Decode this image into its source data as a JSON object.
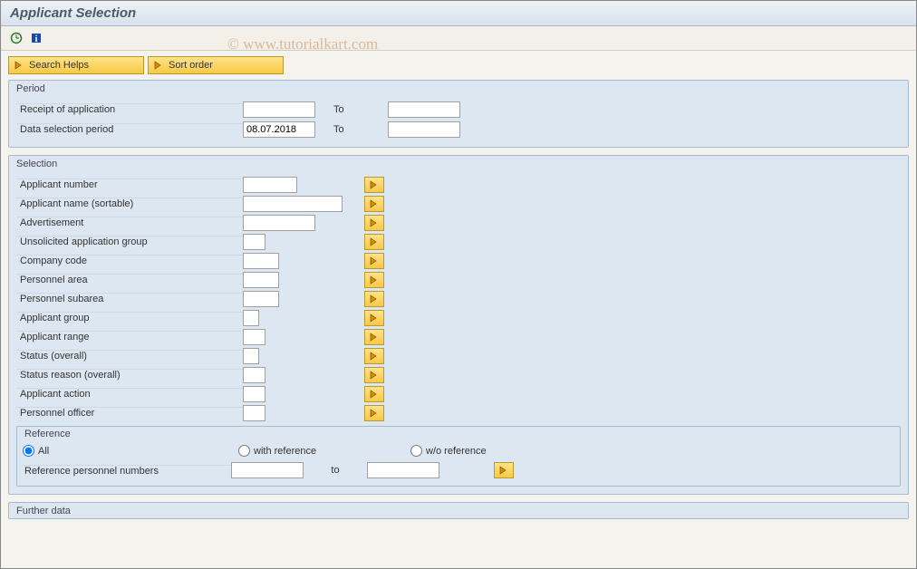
{
  "title": "Applicant Selection",
  "watermark": "© www.tutorialkart.com",
  "buttons": {
    "search_helps": "Search Helps",
    "sort_order": "Sort order"
  },
  "period": {
    "title": "Period",
    "rows": [
      {
        "label": "Receipt of application",
        "from": "",
        "to_label": "To",
        "to": ""
      },
      {
        "label": "Data selection period",
        "from": "08.07.2018",
        "to_label": "To",
        "to": ""
      }
    ]
  },
  "selection": {
    "title": "Selection",
    "rows": [
      {
        "label": "Applicant number",
        "w": "w60",
        "value": ""
      },
      {
        "label": "Applicant name (sortable)",
        "w": "w120",
        "value": ""
      },
      {
        "label": "Advertisement",
        "w": "w80",
        "value": ""
      },
      {
        "label": "Unsolicited application group",
        "w": "w30",
        "value": ""
      },
      {
        "label": "Company code",
        "w": "w40",
        "value": ""
      },
      {
        "label": "Personnel area",
        "w": "w40",
        "value": ""
      },
      {
        "label": "Personnel subarea",
        "w": "w40",
        "value": ""
      },
      {
        "label": "Applicant group",
        "w": "w18",
        "value": ""
      },
      {
        "label": "Applicant range",
        "w": "w30",
        "value": ""
      },
      {
        "label": "Status (overall)",
        "w": "w18",
        "value": ""
      },
      {
        "label": "Status reason (overall)",
        "w": "w30",
        "value": ""
      },
      {
        "label": "Applicant action",
        "w": "w30",
        "value": ""
      },
      {
        "label": "Personnel officer",
        "w": "w30",
        "value": ""
      }
    ],
    "reference": {
      "title": "Reference",
      "radios": {
        "all": "All",
        "with": "with reference",
        "without": "w/o reference",
        "selected": "all"
      },
      "ref_personnel": {
        "label": "Reference personnel numbers",
        "from": "",
        "to_label": "to",
        "to": ""
      }
    }
  },
  "further": {
    "title": "Further data"
  }
}
